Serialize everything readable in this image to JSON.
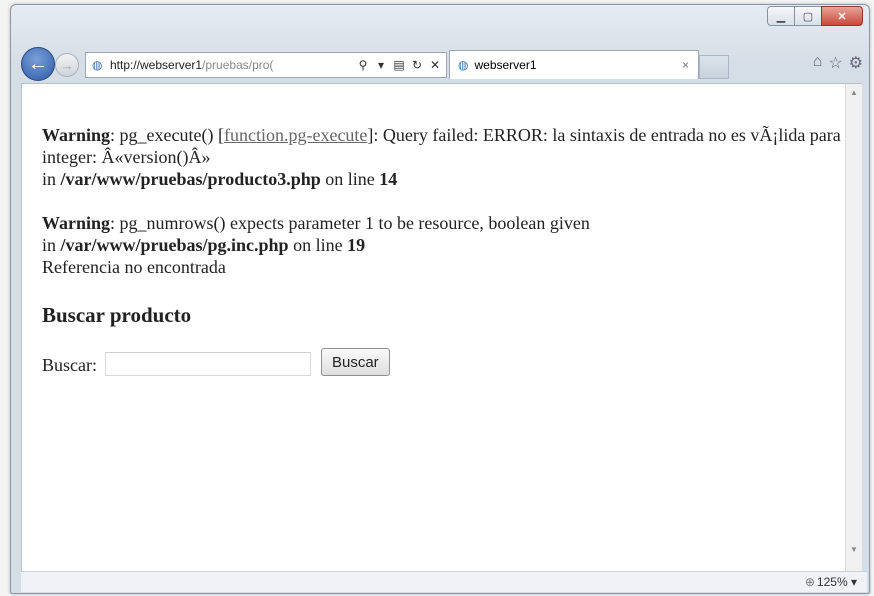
{
  "window": {
    "caption_buttons": [
      "minimize",
      "maximize",
      "close"
    ]
  },
  "nav": {
    "address_host": "http://webserver1",
    "address_path": "/pruebas/pro(",
    "tab_title": "webserver1",
    "tab_close": "×"
  },
  "content": {
    "warning1": {
      "label": "Warning",
      "before_link": ": pg_execute() [",
      "link": "function.pg-execute",
      "after_link": "]: Query failed: ERROR: la sintaxis de entrada no es vÃ¡lida para integer: Â«version()Â»",
      "in_word": "in ",
      "path": "/var/www/pruebas/producto3.php",
      "on_line": " on line ",
      "line": "14"
    },
    "warning2": {
      "label": "Warning",
      "message": ": pg_numrows() expects parameter 1 to be resource, boolean given",
      "in_word": "in ",
      "path": "/var/www/pruebas/pg.inc.php",
      "on_line": " on line ",
      "line": "19"
    },
    "not_found": "Referencia no encontrada",
    "heading": "Buscar producto",
    "search_label": "Buscar:",
    "search_value": "",
    "search_button": "Buscar"
  },
  "status": {
    "zoom": "125%"
  }
}
